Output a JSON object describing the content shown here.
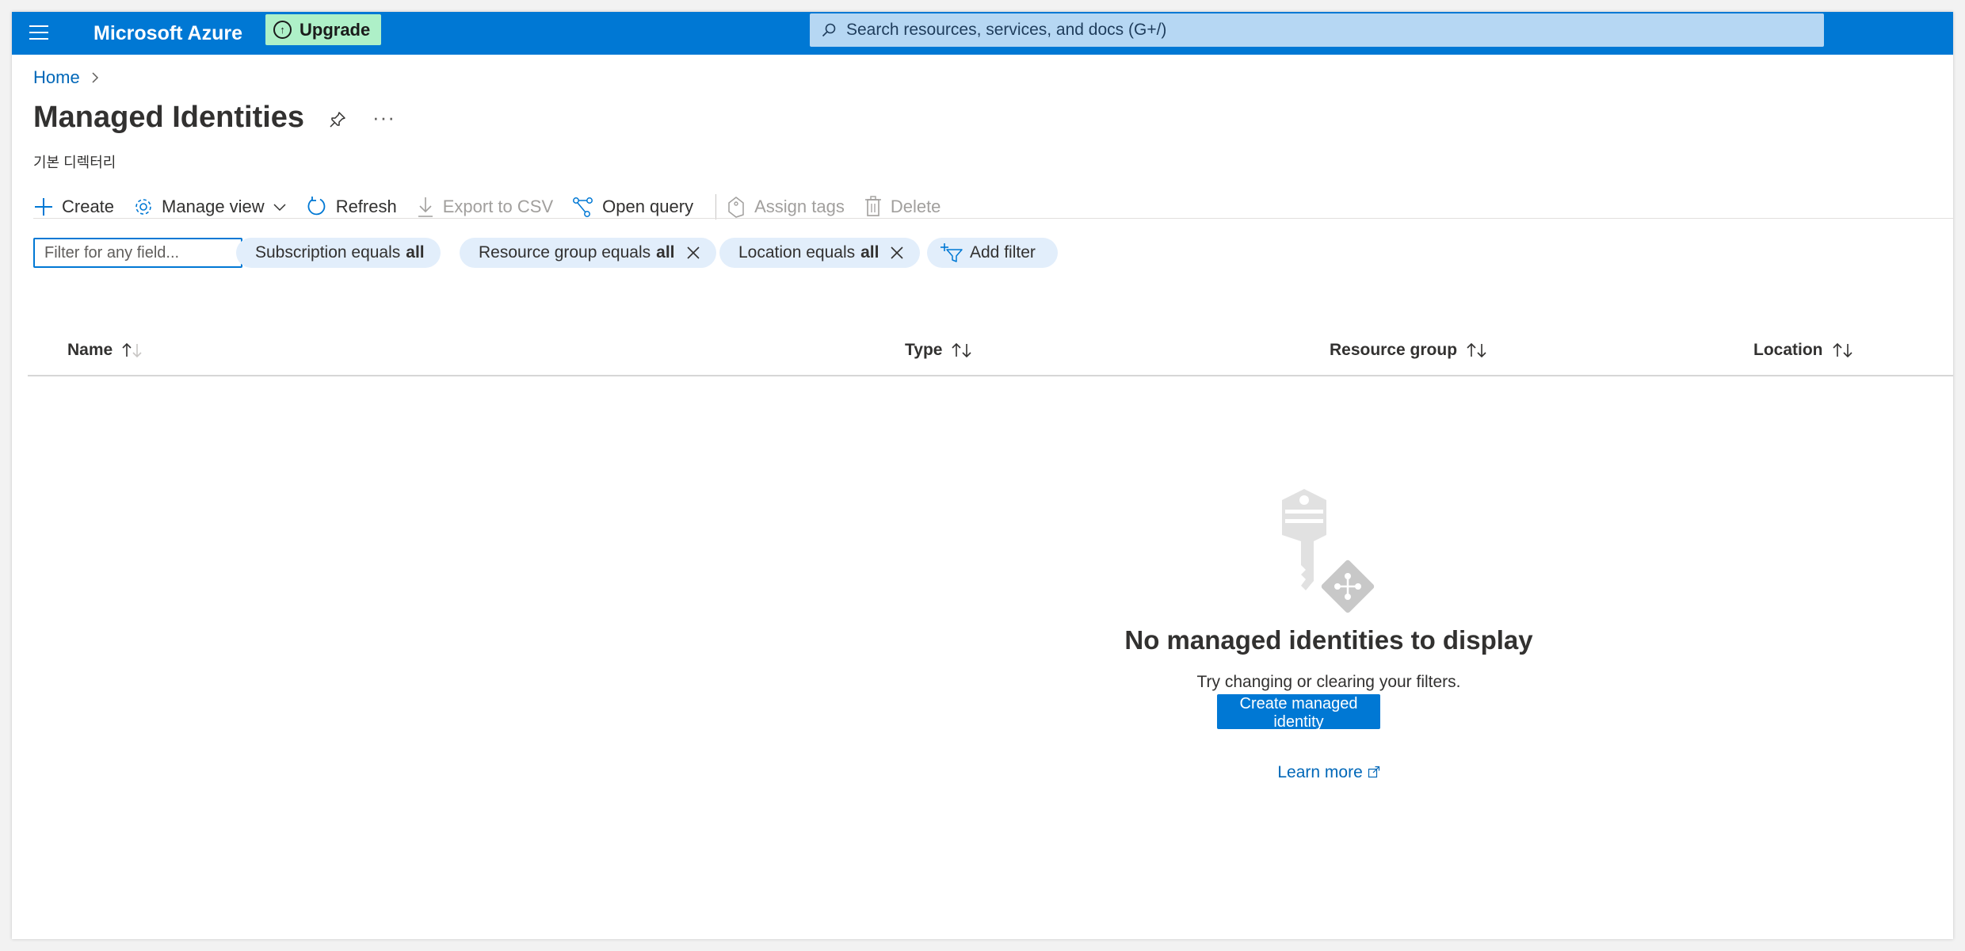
{
  "topbar": {
    "menu_icon": "hamburger-icon",
    "brand": "Microsoft Azure",
    "upgrade_label": "Upgrade",
    "upgrade_icon": "arrow-up-circle-icon",
    "search_placeholder": "Search resources, services, and docs (G+/)",
    "search_icon": "search-icon",
    "bar_color": "#0078d4"
  },
  "breadcrumb": {
    "home": "Home",
    "separator_icon": "chevron-right-icon"
  },
  "page": {
    "title": "Managed Identities",
    "subtitle": "기본 디렉터리",
    "pin_icon": "pin-icon",
    "more_label": "···"
  },
  "commands": {
    "create": "Create",
    "manage_view": "Manage view",
    "refresh": "Refresh",
    "export_csv": "Export to CSV",
    "open_query": "Open query",
    "assign_tags": "Assign tags",
    "delete": "Delete"
  },
  "filters": {
    "input_placeholder": "Filter for any field...",
    "subscription": {
      "label": "Subscription equals",
      "value": "all"
    },
    "resource_group": {
      "label": "Resource group equals",
      "value": "all"
    },
    "location": {
      "label": "Location equals",
      "value": "all"
    },
    "add_filter": "Add filter"
  },
  "table": {
    "columns": [
      "Name",
      "Type",
      "Resource group",
      "Location"
    ]
  },
  "empty_state": {
    "icon": "managed-identity-key-icon",
    "title": "No managed identities to display",
    "description": "Try changing or clearing your filters.",
    "create_button": "Create managed identity",
    "learn_more": "Learn more",
    "external_icon": "external-link-icon"
  },
  "colors": {
    "accent": "#0078d4",
    "link": "#0067b8",
    "pill_bg": "#e2eefb",
    "upgrade_bg": "#aef0c8"
  }
}
